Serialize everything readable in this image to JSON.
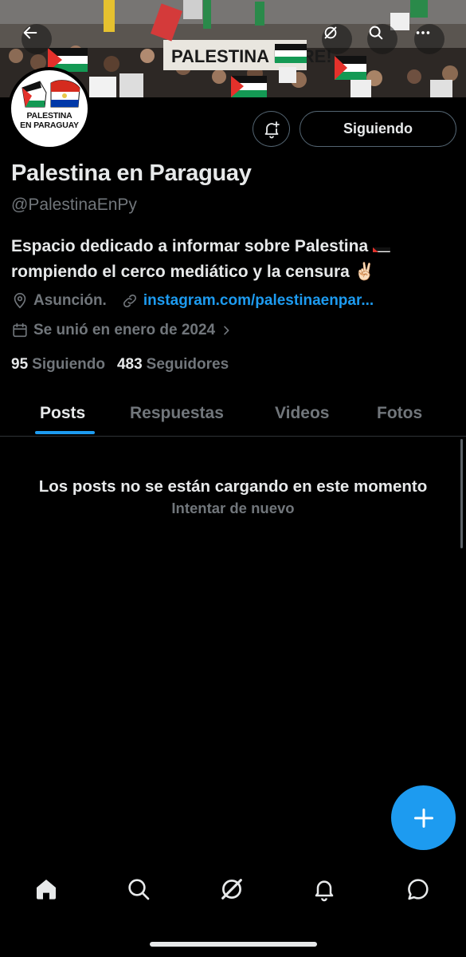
{
  "header": {
    "banner_text": "PALESTINA LIBRE!",
    "icons": [
      "arrow-left-icon",
      "grok-icon",
      "search-icon",
      "more-icon"
    ]
  },
  "avatar": {
    "line1": "PALESTINA",
    "line2": "EN PARAGUAY"
  },
  "actions": {
    "follow_label": "Siguiendo",
    "bell_icon": "bell-plus-icon"
  },
  "profile": {
    "name": "Palestina en Paraguay",
    "handle": "@PalestinaEnPy",
    "bio_line1": "Espacio dedicado a informar sobre Palestina",
    "bio_line2": "rompiendo el cerco mediático y la censura",
    "bio_emoji": "✌🏻",
    "location": "Asunción.",
    "website": "instagram.com/palestinaenpar...",
    "joined": "Se unió en enero de 2024"
  },
  "stats": {
    "following_count": "95",
    "following_label": "Siguiendo",
    "followers_count": "483",
    "followers_label": "Seguidores"
  },
  "tabs": [
    {
      "label": "Posts",
      "active": true
    },
    {
      "label": "Respuestas",
      "active": false
    },
    {
      "label": "Videos",
      "active": false
    },
    {
      "label": "Fotos",
      "active": false
    }
  ],
  "feed": {
    "error_message": "Los posts no se están cargando en este momento",
    "retry_label": "Intentar de nuevo"
  },
  "colors": {
    "accent": "#1d9bf0",
    "background": "#000000",
    "text_primary": "#e7e9ea",
    "text_secondary": "#71767b",
    "border": "#2f3336"
  },
  "bottom_nav": [
    "home-icon",
    "search-icon",
    "grok-icon",
    "notifications-icon",
    "messages-icon"
  ]
}
